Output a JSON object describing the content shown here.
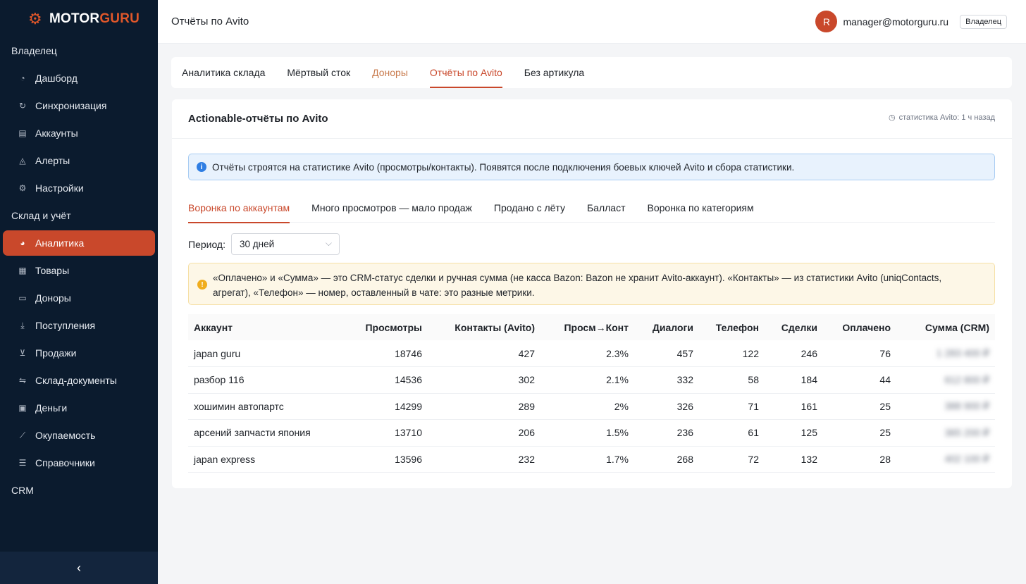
{
  "sidebar": {
    "logo": {
      "part1": "MOTOR",
      "part2": "GURU"
    },
    "groups": [
      {
        "label": "Владелец",
        "items": [
          {
            "label": "Дашборд",
            "icon": "dashboard-icon"
          },
          {
            "label": "Синхронизация",
            "icon": "sync-icon"
          },
          {
            "label": "Аккаунты",
            "icon": "accounts-icon"
          },
          {
            "label": "Алерты",
            "icon": "bell-icon"
          },
          {
            "label": "Настройки",
            "icon": "gear-icon"
          }
        ]
      },
      {
        "label": "Склад и учёт",
        "items": [
          {
            "label": "Аналитика",
            "icon": "pie-chart-icon",
            "active": true
          },
          {
            "label": "Товары",
            "icon": "grid-icon"
          },
          {
            "label": "Доноры",
            "icon": "car-icon"
          },
          {
            "label": "Поступления",
            "icon": "download-icon"
          },
          {
            "label": "Продажи",
            "icon": "cart-icon"
          },
          {
            "label": "Склад-документы",
            "icon": "transfer-icon"
          },
          {
            "label": "Деньги",
            "icon": "wallet-icon"
          },
          {
            "label": "Окупаемость",
            "icon": "trend-icon"
          },
          {
            "label": "Справочники",
            "icon": "book-icon"
          }
        ]
      },
      {
        "label": "CRM",
        "items": []
      }
    ],
    "accent": "#c9482b",
    "bg": "#0b1b2e"
  },
  "header": {
    "title": "Отчёты по Avito",
    "user_initial": "R",
    "email": "manager@motorguru.ru",
    "role": "Владелец"
  },
  "main_tabs": [
    {
      "label": "Аналитика склада"
    },
    {
      "label": "Мёртвый сток"
    },
    {
      "label": "Доноры",
      "muted": true
    },
    {
      "label": "Отчёты по Avito",
      "active": true
    },
    {
      "label": "Без артикула"
    }
  ],
  "card": {
    "title": "Actionable-отчёты по Avito",
    "meta": "статистика Avito: 1 ч назад",
    "info": "Отчёты строятся на статистике Avito (просмотры/контакты). Появятся после подключения боевых ключей Avito и сбора статистики.",
    "sub_tabs": [
      {
        "label": "Воронка по аккаунтам",
        "active": true
      },
      {
        "label": "Много просмотров — мало продаж"
      },
      {
        "label": "Продано с лёту"
      },
      {
        "label": "Балласт"
      },
      {
        "label": "Воронка по категориям"
      }
    ],
    "period_label": "Период:",
    "period_value": "30 дней",
    "warning_line1": "«Оплачено» и «Сумма» — это CRM-статус сделки и ручная сумма (не касса Bazon: Bazon не хранит Avito-аккаунт). «Контакты» — из статистики Avito (uniqContacts,",
    "warning_line2": "агрегат), «Телефон» — номер, оставленный в чате: это разные метрики."
  },
  "table": {
    "columns": [
      "Аккаунт",
      "Просмотры",
      "Контакты (Avito)",
      "Просм→Конт",
      "Диалоги",
      "Телефон",
      "Сделки",
      "Оплачено",
      "Сумма (CRM)"
    ],
    "rows": [
      [
        "japan guru",
        "18746",
        "427",
        "2.3%",
        "457",
        "122",
        "246",
        "76",
        "1 283 400 ₽"
      ],
      [
        "разбор 116",
        "14536",
        "302",
        "2.1%",
        "332",
        "58",
        "184",
        "44",
        "612 800 ₽"
      ],
      [
        "хошимин автопартс",
        "14299",
        "289",
        "2%",
        "326",
        "71",
        "161",
        "25",
        "388 900 ₽"
      ],
      [
        "арсений запчасти япония",
        "13710",
        "206",
        "1.5%",
        "236",
        "61",
        "125",
        "25",
        "365 200 ₽"
      ],
      [
        "japan express",
        "13596",
        "232",
        "1.7%",
        "268",
        "72",
        "132",
        "28",
        "402 100 ₽"
      ]
    ]
  }
}
